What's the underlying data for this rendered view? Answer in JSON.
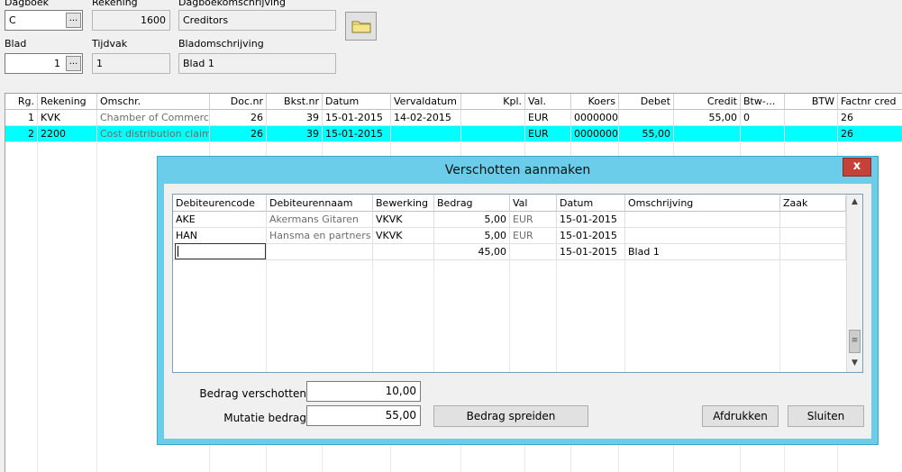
{
  "header": {
    "dagboek_label": "Dagboek",
    "dagboek_value": "C",
    "rekening_label": "Rekening",
    "rekening_value": "1600",
    "dagboekomschrijving_label": "Dagboekomschrijving",
    "dagboekomschrijving_value": "Creditors",
    "blad_label": "Blad",
    "blad_value": "1",
    "tijdvak_label": "Tijdvak",
    "tijdvak_value": "1",
    "bladomschrijving_label": "Bladomschrijving",
    "bladomschrijving_value": "Blad 1",
    "lookup_label": "...",
    "folder_icon": "folder-icon"
  },
  "grid": {
    "columns": [
      "Rg.",
      "Rekening",
      "Omschr.",
      "Doc.nr",
      "Bkst.nr",
      "Datum",
      "Vervaldatum",
      "Kpl.",
      "Val.",
      "Koers",
      "Debet",
      "Credit",
      "Btw-...",
      "BTW",
      "Factnr cred"
    ],
    "rows": [
      [
        "1",
        "KVK",
        "Chamber of Commerc",
        "26",
        "39",
        "15-01-2015",
        "14-02-2015",
        "",
        "EUR",
        "00000000",
        "",
        "55,00",
        "0",
        "",
        "26"
      ],
      [
        "2",
        "2200",
        "Cost distribution claim",
        "26",
        "39",
        "15-01-2015",
        "",
        "",
        "EUR",
        "00000000",
        "55,00",
        "",
        "",
        "",
        "26"
      ]
    ],
    "selected_row": 1,
    "selection_color": "#00ffff"
  },
  "dialog": {
    "title": "Verschotten aanmaken",
    "close_label": "x",
    "close_color": "#c5423a",
    "title_color": "#6bcde9",
    "columns": [
      "Debiteurencode",
      "Debiteurennaam",
      "Bewerking",
      "Bedrag",
      "Val",
      "Datum",
      "Omschrijving",
      "Zaak"
    ],
    "rows": [
      [
        "AKE",
        "Akermans Gitaren",
        "VKVK",
        "5,00",
        "EUR",
        "15-01-2015",
        "",
        ""
      ],
      [
        "HAN",
        "Hansma en partners",
        "VKVK",
        "5,00",
        "EUR",
        "15-01-2015",
        "",
        ""
      ],
      [
        "",
        "",
        "",
        "45,00",
        "",
        "15-01-2015",
        "Blad 1",
        ""
      ]
    ],
    "scroll_up_icon": "chevron-up-icon",
    "scroll_down_icon": "chevron-down-icon",
    "bedrag_verschotten_label": "Bedrag verschotten",
    "bedrag_verschotten_value": "10,00",
    "mutatie_bedrag_label": "Mutatie bedrag",
    "mutatie_bedrag_value": "55,00",
    "spread_button": "Bedrag spreiden",
    "print_button": "Afdrukken",
    "close_button": "Sluiten"
  }
}
